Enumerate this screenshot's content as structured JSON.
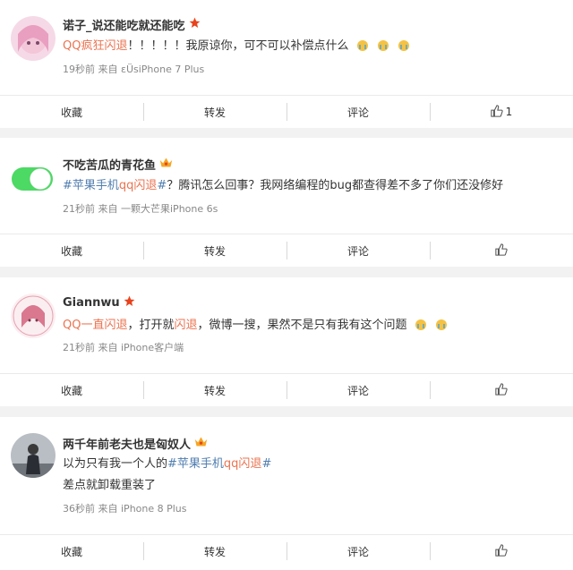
{
  "actions": {
    "collect": "收藏",
    "repost": "转发",
    "comment": "评论"
  },
  "comments": [
    {
      "name": "诺子_说还能吃就还能吃",
      "segments": [
        {
          "t": "QQ疯狂",
          "c": "hl"
        },
        {
          "t": "闪退",
          "c": "hl"
        },
        {
          "t": "！！！！！我原谅你，可不可以补偿点什么",
          "c": ""
        }
      ],
      "emoji_count": 3,
      "time": "19秒前",
      "from_label": "来自",
      "source": "εÜsiPhone 7 Plus",
      "likes": "1"
    },
    {
      "name": "不吃苦瓜的青花鱼",
      "segments": [
        {
          "t": "#苹果手机",
          "c": "topic"
        },
        {
          "t": "qq闪退",
          "c": "hl"
        },
        {
          "t": "#",
          "c": "topic"
        },
        {
          "t": "？腾讯怎么回事？我网络编程的bug都查得差不多了你们还没修好",
          "c": ""
        }
      ],
      "time": "21秒前",
      "from_label": "来自",
      "source": "一颗大芒果iPhone 6s",
      "likes": ""
    },
    {
      "name": "Giannwu",
      "segments": [
        {
          "t": "QQ一直",
          "c": "hl"
        },
        {
          "t": "闪退",
          "c": "hl"
        },
        {
          "t": "，打开就",
          "c": ""
        },
        {
          "t": "闪退",
          "c": "hl"
        },
        {
          "t": "，微博一搜，果然不是只有我有这个问题",
          "c": ""
        }
      ],
      "emoji_count": 2,
      "time": "21秒前",
      "from_label": "来自",
      "source": "iPhone客户端",
      "likes": ""
    },
    {
      "name": "两千年前老夫也是匈奴人",
      "segments": [
        {
          "t": "以为只有我一个人的",
          "c": ""
        },
        {
          "t": "#苹果手机",
          "c": "topic"
        },
        {
          "t": "qq闪退",
          "c": "hl"
        },
        {
          "t": "#",
          "c": "topic"
        }
      ],
      "line2": "差点就卸载重装了",
      "time": "36秒前",
      "from_label": "来自",
      "source": "iPhone 8 Plus",
      "likes": ""
    }
  ]
}
